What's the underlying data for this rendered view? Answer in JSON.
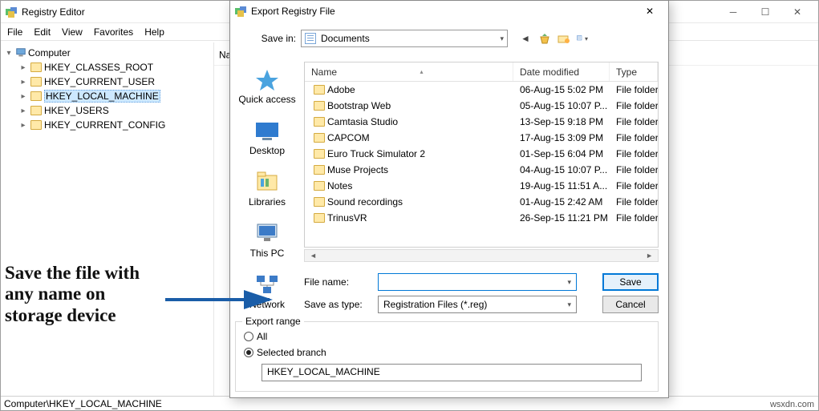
{
  "main": {
    "title": "Registry Editor",
    "menus": [
      "File",
      "Edit",
      "View",
      "Favorites",
      "Help"
    ],
    "tree": [
      {
        "label": "Computer",
        "indent": 0,
        "expanded": true,
        "icon": "comp"
      },
      {
        "label": "HKEY_CLASSES_ROOT",
        "indent": 1,
        "icon": "folder"
      },
      {
        "label": "HKEY_CURRENT_USER",
        "indent": 1,
        "icon": "folder"
      },
      {
        "label": "HKEY_LOCAL_MACHINE",
        "indent": 1,
        "icon": "folder",
        "selected": true
      },
      {
        "label": "HKEY_USERS",
        "indent": 1,
        "icon": "folder"
      },
      {
        "label": "HKEY_CURRENT_CONFIG",
        "indent": 1,
        "icon": "folder"
      }
    ],
    "right_col_header": "Na",
    "statusbar": "Computer\\HKEY_LOCAL_MACHINE"
  },
  "dialog": {
    "title": "Export Registry File",
    "save_in_label": "Save in:",
    "save_in_value": "Documents",
    "places": [
      "Quick access",
      "Desktop",
      "Libraries",
      "This PC",
      "Network"
    ],
    "columns": [
      "Name",
      "Date modified",
      "Type"
    ],
    "files": [
      {
        "name": "Adobe",
        "date": "06-Aug-15 5:02 PM",
        "type": "File folder"
      },
      {
        "name": "Bootstrap Web",
        "date": "05-Aug-15 10:07 P...",
        "type": "File folder"
      },
      {
        "name": "Camtasia Studio",
        "date": "13-Sep-15 9:18 PM",
        "type": "File folder"
      },
      {
        "name": "CAPCOM",
        "date": "17-Aug-15 3:09 PM",
        "type": "File folder"
      },
      {
        "name": "Euro Truck Simulator 2",
        "date": "01-Sep-15 6:04 PM",
        "type": "File folder"
      },
      {
        "name": "Muse Projects",
        "date": "04-Aug-15 10:07 P...",
        "type": "File folder"
      },
      {
        "name": "Notes",
        "date": "19-Aug-15 11:51 A...",
        "type": "File folder"
      },
      {
        "name": "Sound recordings",
        "date": "01-Aug-15 2:42 AM",
        "type": "File folder"
      },
      {
        "name": "TrinusVR",
        "date": "26-Sep-15 11:21 PM",
        "type": "File folder"
      }
    ],
    "filename_label": "File name:",
    "filename_value": "",
    "saveas_label": "Save as type:",
    "saveas_value": "Registration Files (*.reg)",
    "save_btn": "Save",
    "cancel_btn": "Cancel",
    "export_range_label": "Export range",
    "radio_all": "All",
    "radio_branch": "Selected branch",
    "branch_value": "HKEY_LOCAL_MACHINE"
  },
  "annotation": "Save the file with any name on storage device",
  "watermark": "wsxdn.com"
}
